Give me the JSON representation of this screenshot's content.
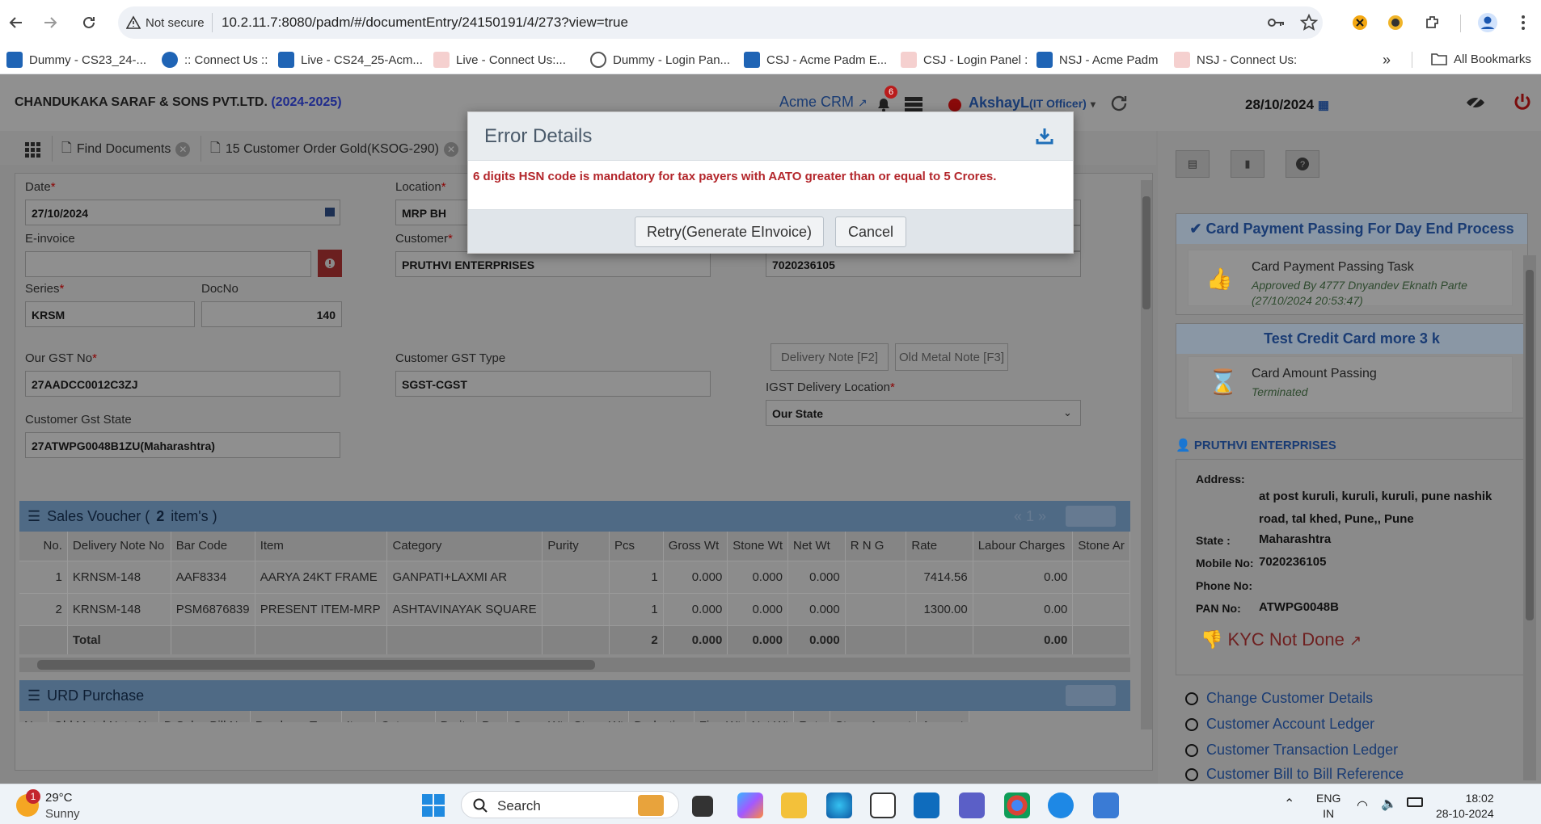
{
  "browser": {
    "security_label": "Not secure",
    "url": "10.2.11.7:8080/padm/#/documentEntry/24150191/4/273?view=true",
    "bookmarks": [
      {
        "label": "Dummy  - CS23_24-...",
        "color": "#1f64b5"
      },
      {
        "label": ":: Connect Us ::",
        "color": "#1f64b5"
      },
      {
        "label": "Live - CS24_25-Acm...",
        "color": "#1f64b5"
      },
      {
        "label": "Live - Connect Us:...",
        "color": "#d9534f"
      },
      {
        "label": "Dummy - Login Pan...",
        "color": "#555555"
      },
      {
        "label": "CSJ - Acme Padm E...",
        "color": "#1f64b5"
      },
      {
        "label": "CSJ - Login Panel :",
        "color": "#d9534f"
      },
      {
        "label": "NSJ - Acme Padm",
        "color": "#1f64b5"
      },
      {
        "label": "NSJ - Connect Us:",
        "color": "#d9534f"
      }
    ],
    "more_bookmarks": "»",
    "all_bookmarks": "All Bookmarks"
  },
  "header": {
    "company": "CHANDUKAKA SARAF & SONS PVT.LTD.",
    "year": "(2024-2025)",
    "crm_link": "Acme CRM",
    "notification_count": "6",
    "user_name": "AkshayL",
    "user_role": "(IT Officer)",
    "date": "28/10/2024"
  },
  "tabs": [
    {
      "label": "Find Documents"
    },
    {
      "label": "15 Customer Order Gold(KSOG-290)"
    }
  ],
  "form": {
    "date_label": "Date",
    "date_value": "27/10/2024",
    "location_label": "Location",
    "location_value": "MRP BH",
    "einvoice_label": "E-invoice",
    "einvoice_value": "",
    "customer_label": "Customer",
    "customer_value": "PRUTHVI ENTERPRISES",
    "mobile_value": "7020236105",
    "series_label": "Series",
    "series_value": "KRSM",
    "docno_label": "DocNo",
    "docno_value": "140",
    "our_gst_label": "Our GST No",
    "our_gst_value": "27AADCC0012C3ZJ",
    "cust_gst_type_label": "Customer GST Type",
    "cust_gst_type_value": "SGST-CGST",
    "delivery_note_btn": "Delivery Note [F2]",
    "old_metal_btn": "Old Metal Note [F3]",
    "igst_label": "IGST Delivery Location",
    "igst_value": "Our State",
    "cust_gst_state_label": "Customer Gst State",
    "cust_gst_state_value": "27ATWPG0048B1ZU(Maharashtra)"
  },
  "sales_voucher": {
    "title": "Sales Voucher (",
    "count": "2",
    "suffix": "item's )",
    "pager": "«  1  »",
    "columns": [
      "No.",
      "Delivery Note No",
      "Bar Code",
      "Item",
      "Category",
      "Purity",
      "Pcs",
      "Gross Wt",
      "Stone Wt",
      "Net Wt",
      "R N G",
      "Rate",
      "Labour Charges",
      "Stone Ar"
    ],
    "rows": [
      [
        "1",
        "KRNSM-148",
        "AAF8334",
        "AARYA 24KT FRAME",
        "GANPATI+LAXMI AR",
        "",
        "1",
        "0.000",
        "0.000",
        "0.000",
        "",
        "7414.56",
        "0.00",
        ""
      ],
      [
        "2",
        "KRNSM-148",
        "PSM6876839",
        "PRESENT ITEM-MRP",
        "ASHTAVINAYAK SQUARE",
        "",
        "1",
        "0.000",
        "0.000",
        "0.000",
        "",
        "1300.00",
        "0.00",
        ""
      ]
    ],
    "total": [
      "",
      "Total",
      "",
      "",
      "",
      "",
      "2",
      "0.000",
      "0.000",
      "0.000",
      "",
      "",
      "0.00",
      ""
    ]
  },
  "urd_purchase": {
    "title": "URD Purchase",
    "columns": [
      "No.",
      "Old Metal Note No",
      "D.Sales Bill No",
      "Purchase Type",
      "Item",
      "Category",
      "Purity",
      "Pcs",
      "Gross Wt",
      "Stone Wt",
      "Deduction",
      "Fine Wt",
      "Net Wt",
      "Rate",
      "Stone Amount",
      "Amount"
    ]
  },
  "right_panel": {
    "card1_title": "Card Payment Passing For Day End Process",
    "task1_name": "Card Payment Passing Task",
    "task1_sub": "Approved By 4777 Dnyandev Eknath Parte (27/10/2024 20:53:47)",
    "card2_title": "Test Credit Card more 3 k",
    "task2_name": "Card Amount Passing",
    "task2_sub": "Terminated",
    "customer_heading": "PRUTHVI ENTERPRISES",
    "address_label": "Address:",
    "address_value": "at post kuruli, kuruli, kuruli, pune nashik road, tal khed, Pune,, Pune",
    "state_label": "State :",
    "state_value": "Maharashtra",
    "mobile_label": "Mobile No:",
    "mobile_value": "7020236105",
    "phone_label": "Phone No:",
    "phone_value": "",
    "pan_label": "PAN No:",
    "pan_value": "ATWPG0048B",
    "kyc": "KYC Not Done",
    "links": [
      "Change Customer Details",
      "Customer Account Ledger",
      "Customer Transaction Ledger",
      "Customer Bill to Bill Reference"
    ]
  },
  "modal": {
    "title": "Error Details",
    "message": "6 digits HSN code is mandatory for tax payers with AATO greater than or equal to 5 Crores.",
    "retry_label": "Retry(Generate EInvoice)",
    "cancel_label": "Cancel"
  },
  "taskbar": {
    "weather_badge": "1",
    "temperature": "29°C",
    "weather_text": "Sunny",
    "search_placeholder": "Search",
    "lang_top": "ENG",
    "lang_bottom": "IN",
    "time": "18:02",
    "date": "28-10-2024"
  },
  "colors": {
    "error_text": "#b3262b",
    "link_blue": "#1a3c74",
    "overlay_gray": "#878787"
  }
}
